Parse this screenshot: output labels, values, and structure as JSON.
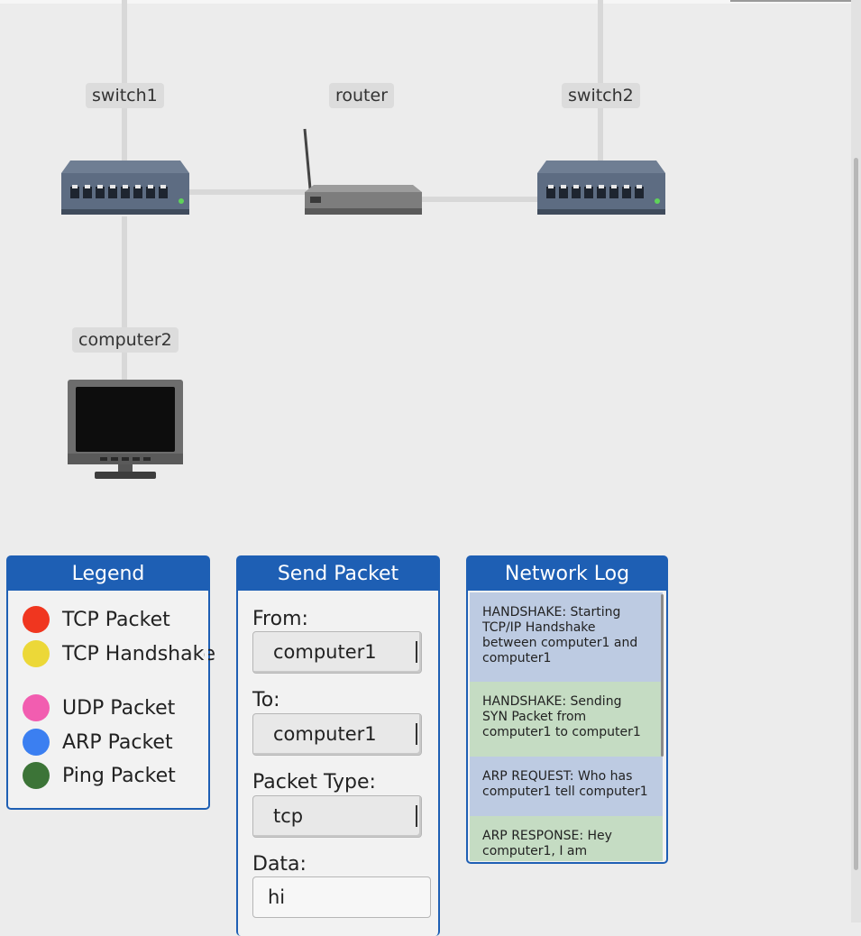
{
  "topology": {
    "nodes": [
      {
        "id": "switch1",
        "label": "switch1",
        "icon": "network-switch-icon"
      },
      {
        "id": "router",
        "label": "router",
        "icon": "router-icon"
      },
      {
        "id": "switch2",
        "label": "switch2",
        "icon": "network-switch-icon"
      },
      {
        "id": "computer2",
        "label": "computer2",
        "icon": "monitor-icon"
      }
    ]
  },
  "legend": {
    "title": "Legend",
    "items": [
      {
        "label": "TCP Packet",
        "color": "#f0361f"
      },
      {
        "label": "TCP Handshake",
        "color": "#ecd838"
      },
      {
        "label": "UDP Packet",
        "color": "#f25db0"
      },
      {
        "label": "ARP Packet",
        "color": "#3b7ff1"
      },
      {
        "label": "Ping Packet",
        "color": "#3c7437"
      }
    ]
  },
  "send_packet": {
    "title": "Send Packet",
    "from_label": "From:",
    "from_value": "computer1",
    "to_label": "To:",
    "to_value": "computer1",
    "type_label": "Packet Type:",
    "type_value": "tcp",
    "data_label": "Data:",
    "data_value": "hi"
  },
  "network_log": {
    "title": "Network Log",
    "entries": [
      {
        "text": "HANDSHAKE: Starting TCP/IP Handshake between computer1 and computer1",
        "color": "blue"
      },
      {
        "text": "HANDSHAKE: Sending SYN Packet from computer1 to computer1",
        "color": "green"
      },
      {
        "text": "ARP REQUEST: Who has computer1 tell computer1",
        "color": "blue"
      },
      {
        "text": "ARP RESPONSE: Hey computer1, I am",
        "color": "green"
      }
    ]
  },
  "colors": {
    "accent": "#1e5fb4",
    "background": "#ececec"
  }
}
